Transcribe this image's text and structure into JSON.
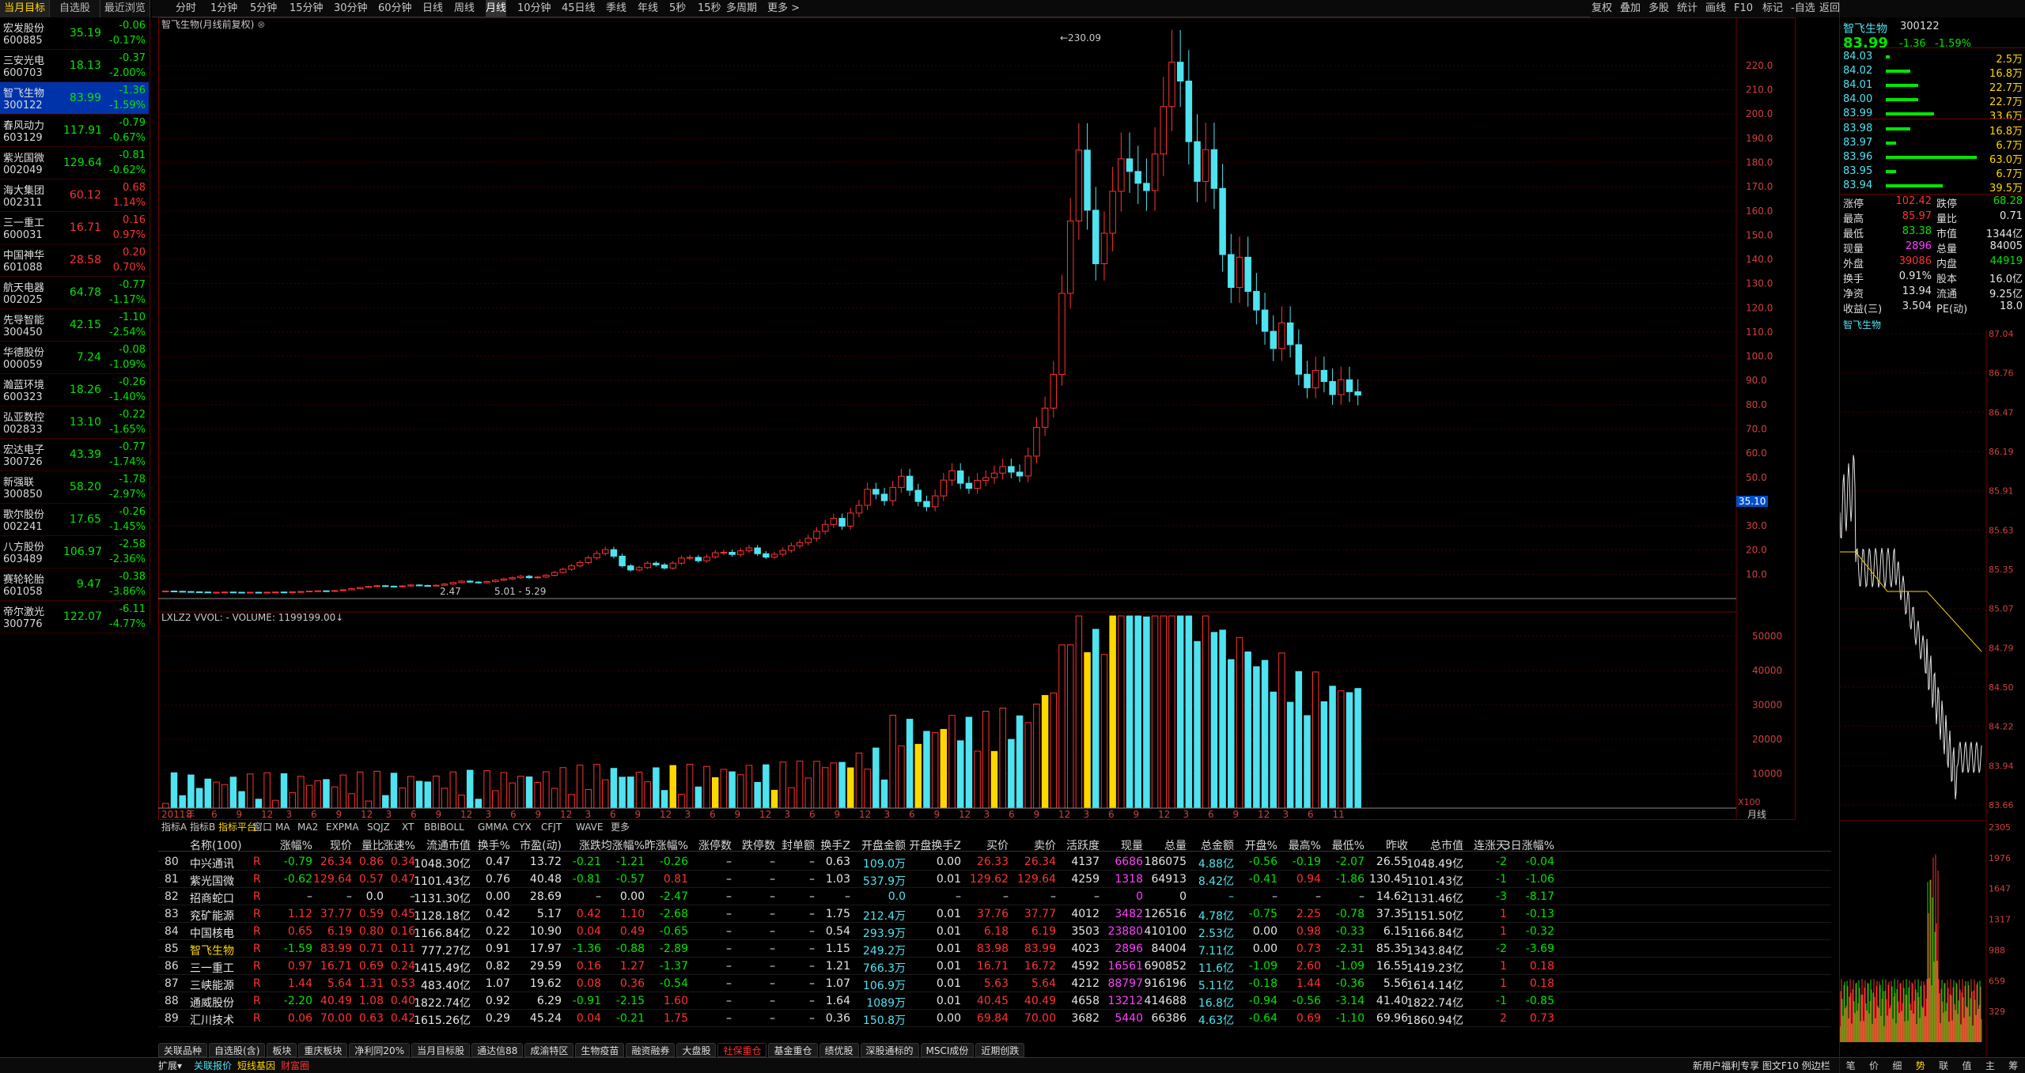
{
  "left": {
    "tabs": [
      "当月目标",
      "自选股",
      "最近浏览"
    ],
    "stocks": [
      {
        "name": "宏发股份",
        "code": "600885",
        "price": "35.19",
        "change": "-0.06",
        "pct": "-0.17%",
        "dir": "down"
      },
      {
        "name": "三安光电",
        "code": "600703",
        "price": "18.13",
        "change": "-0.37",
        "pct": "-2.00%",
        "dir": "down"
      },
      {
        "name": "智飞生物",
        "code": "300122",
        "price": "83.99",
        "change": "-1.36",
        "pct": "-1.59%",
        "dir": "down",
        "selected": true
      },
      {
        "name": "春风动力",
        "code": "603129",
        "price": "117.91",
        "change": "-0.79",
        "pct": "-0.67%",
        "dir": "down"
      },
      {
        "name": "紫光国微",
        "code": "002049",
        "price": "129.64",
        "change": "-0.81",
        "pct": "-0.62%",
        "dir": "down"
      },
      {
        "name": "海大集团",
        "code": "002311",
        "price": "60.12",
        "change": "0.68",
        "pct": "1.14%",
        "dir": "up"
      },
      {
        "name": "三一重工",
        "code": "600031",
        "price": "16.71",
        "change": "0.16",
        "pct": "0.97%",
        "dir": "up"
      },
      {
        "name": "中国神华",
        "code": "601088",
        "price": "28.58",
        "change": "0.20",
        "pct": "0.70%",
        "dir": "up"
      },
      {
        "name": "航天电器",
        "code": "002025",
        "price": "64.78",
        "change": "-0.77",
        "pct": "-1.17%",
        "dir": "down"
      },
      {
        "name": "先导智能",
        "code": "300450",
        "price": "42.15",
        "change": "-1.10",
        "pct": "-2.54%",
        "dir": "down"
      },
      {
        "name": "华德股份",
        "code": "000059",
        "price": "7.24",
        "change": "-0.08",
        "pct": "-1.09%",
        "dir": "down"
      },
      {
        "name": "瀚蓝环境",
        "code": "600323",
        "price": "18.26",
        "change": "-0.26",
        "pct": "-1.40%",
        "dir": "down"
      },
      {
        "name": "弘亚数控",
        "code": "002833",
        "price": "13.10",
        "change": "-0.22",
        "pct": "-1.65%",
        "dir": "down"
      },
      {
        "name": "宏达电子",
        "code": "300726",
        "price": "43.39",
        "change": "-0.77",
        "pct": "-1.74%",
        "dir": "down"
      },
      {
        "name": "新强联",
        "code": "300850",
        "price": "58.20",
        "change": "-1.78",
        "pct": "-2.97%",
        "dir": "down"
      },
      {
        "name": "歌尔股份",
        "code": "002241",
        "price": "17.65",
        "change": "-0.26",
        "pct": "-1.45%",
        "dir": "down"
      },
      {
        "name": "八方股份",
        "code": "603489",
        "price": "106.97",
        "change": "-2.58",
        "pct": "-2.36%",
        "dir": "down"
      },
      {
        "name": "赛轮轮胎",
        "code": "601058",
        "price": "9.47",
        "change": "-0.38",
        "pct": "-3.86%",
        "dir": "down"
      },
      {
        "name": "帝尔激光",
        "code": "300776",
        "price": "122.07",
        "change": "-6.11",
        "pct": "-4.77%",
        "dir": "down"
      }
    ]
  },
  "periods": [
    "分时",
    "1分钟",
    "5分钟",
    "15分钟",
    "30分钟",
    "60分钟",
    "日线",
    "周线",
    "月线",
    "10分钟",
    "45日线",
    "季线",
    "年线",
    "5秒",
    "15秒",
    "多周期",
    "更多 >"
  ],
  "active_period": "月线",
  "tools": [
    "复权",
    "叠加",
    "多股",
    "统计",
    "画线",
    "F10",
    "标记",
    "-自选",
    "返回"
  ],
  "chart": {
    "title": "智飞生物(月线前复权)",
    "high_label": "230.09",
    "low_label": "2.47",
    "range_label": "5.01 - 5.29",
    "vol_title": "LXLZ2 VVOL: - VOLUME: 1199199.00↓",
    "x_labels": [
      "2011年",
      "3",
      "6",
      "9",
      "12",
      "3",
      "6",
      "9",
      "12",
      "3",
      "6",
      "9",
      "12",
      "3",
      "6",
      "9",
      "12",
      "3",
      "6",
      "9",
      "12",
      "3",
      "6",
      "9",
      "12",
      "3",
      "6",
      "9",
      "12",
      "3",
      "6",
      "9",
      "12",
      "3",
      "6",
      "9",
      "12",
      "3",
      "6",
      "9",
      "12",
      "3",
      "6",
      "9",
      "12",
      "3",
      "6",
      "11"
    ],
    "price_ticks": [
      "220.0",
      "210.0",
      "200.0",
      "190.0",
      "180.0",
      "170.0",
      "160.0",
      "150.0",
      "140.0",
      "130.0",
      "120.0",
      "110.0",
      "100.0",
      "90.0",
      "80.0",
      "70.0",
      "60.0",
      "50.0",
      "40.0",
      "30.0",
      "20.0",
      "10.0"
    ],
    "vol_ticks": [
      "50000",
      "40000",
      "30000",
      "20000",
      "10000"
    ],
    "vol_unit": "X100",
    "period_label": "月线",
    "indicator_tabs": [
      "指标A",
      "指标B",
      "指标平台",
      "窗口",
      "MA",
      "MA2",
      "EXPMA",
      "SQJZ",
      "XT",
      "BBIBOLL",
      "GMMA",
      "CYX",
      "CFJT",
      "WAVE",
      "更多"
    ],
    "marker": "35.10"
  },
  "chart_data": {
    "type": "candlestick",
    "title": "智飞生物(月线前复权)",
    "closes": [
      3.1,
      3.0,
      2.9,
      2.8,
      2.7,
      2.6,
      2.6,
      2.7,
      2.6,
      2.5,
      2.6,
      2.5,
      2.6,
      2.7,
      2.6,
      2.8,
      2.9,
      3.1,
      3.2,
      3.0,
      3.3,
      3.6,
      4.1,
      4.6,
      5.0,
      5.3,
      5.1,
      4.9,
      5.2,
      5.6,
      5.4,
      5.3,
      5.5,
      6.0,
      6.6,
      7.2,
      6.8,
      6.5,
      7.0,
      7.6,
      8.1,
      8.6,
      9.2,
      8.6,
      8.9,
      9.6,
      10.8,
      12.1,
      13.5,
      14.9,
      16.8,
      18.6,
      20.2,
      17.5,
      13.5,
      11.8,
      12.8,
      14.6,
      13.9,
      12.6,
      14.6,
      16.7,
      17.0,
      15.6,
      17.2,
      18.9,
      19.1,
      18.2,
      19.7,
      20.9,
      18.5,
      17.1,
      18.3,
      19.9,
      21.8,
      23.1,
      24.9,
      27.8,
      30.6,
      33.1,
      29.9,
      35.3,
      38.5,
      45.1,
      43.1,
      40.4,
      45.9,
      50.5,
      44.7,
      40.1,
      37.9,
      42.4,
      48.9,
      52.7,
      47.6,
      45.5,
      48.8,
      49.9,
      51.8,
      54.5,
      52.2,
      50.6,
      58.8,
      70.7,
      78.6,
      92.5,
      126.0,
      155.9,
      185.1,
      160.3,
      138.2,
      150.8,
      168.1,
      181.5,
      176.3,
      171.4,
      168.4,
      183.5,
      203.1,
      221.4,
      213.6,
      188.6,
      172.2,
      185.3,
      169.3,
      142.0,
      128.4,
      140.9,
      126.8,
      119.1,
      110.3,
      103.2,
      113.8,
      104.8,
      92.6,
      87.0,
      94.2,
      89.6,
      84.2,
      90.3,
      85.4,
      83.99
    ],
    "volume_ticks": [
      50000,
      40000,
      30000,
      20000,
      10000
    ],
    "price_range": [
      0,
      230.09
    ]
  },
  "table": {
    "headers": [
      "",
      "名称(100)",
      "",
      "涨幅%",
      "现价",
      "量比",
      "涨速%",
      "流通市值",
      "换手%",
      "市盈(动)",
      "涨跌",
      "均涨幅%",
      "昨涨幅%",
      "涨停数",
      "跌停数",
      "封单额",
      "换手Z",
      "开盘金额",
      "开盘换手Z",
      "买价",
      "卖价",
      "活跃度",
      "现量",
      "总量",
      "总金额",
      "开盘%",
      "最高%",
      "最低%",
      "昨收",
      "总市值",
      "连涨天",
      "3日涨幅%"
    ],
    "rows": [
      {
        "n": "80",
        "name": "中兴通讯",
        "f": "R",
        "pct": "-0.79",
        "price": "26.34",
        "lb": "0.86",
        "zs": "0.34",
        "ltsz": "1048.30亿",
        "hs": "0.47",
        "syl": "13.72",
        "zd": "-0.21",
        "jzf": "-1.21",
        "zzf": "-0.26",
        "ztd": "–",
        "dtd": "–",
        "fd": "–",
        "hsz": "0.63",
        "kpje": "109.0万",
        "kphs": "0.00",
        "buy": "26.33",
        "sell": "26.34",
        "hyd": "4137",
        "xl": "6686",
        "zl": "186075",
        "zje": "4.88亿",
        "kp": "-0.56",
        "zg": "-0.19",
        "zd2": "-2.07",
        "zs2": "26.55",
        "zsz": "1048.49亿",
        "lzt": "-2",
        "zf3": "-0.04"
      },
      {
        "n": "81",
        "name": "紫光国微",
        "f": "R",
        "pct": "-0.62",
        "price": "129.64",
        "lb": "0.57",
        "zs": "0.47",
        "ltsz": "1101.43亿",
        "hs": "0.76",
        "syl": "40.48",
        "zd": "-0.81",
        "jzf": "-0.57",
        "zzf": "0.81",
        "ztd": "–",
        "dtd": "–",
        "fd": "–",
        "hsz": "1.03",
        "kpje": "537.9万",
        "kphs": "0.01",
        "buy": "129.62",
        "sell": "129.64",
        "hyd": "4259",
        "xl": "1318",
        "zl": "64913",
        "zje": "8.42亿",
        "kp": "-0.41",
        "zg": "0.94",
        "zd2": "-1.86",
        "zs2": "130.45",
        "zsz": "1101.43亿",
        "lzt": "-1",
        "zf3": "-1.06"
      },
      {
        "n": "82",
        "name": "招商蛇口",
        "f": "R",
        "pct": "–",
        "price": "–",
        "lb": "0.0",
        "zs": "–",
        "ltsz": "1131.30亿",
        "hs": "0.00",
        "syl": "28.69",
        "zd": "–",
        "jzf": "0.00",
        "zzf": "-2.47",
        "ztd": "–",
        "dtd": "–",
        "fd": "–",
        "hsz": "–",
        "kpje": "0.0",
        "kphs": "–",
        "buy": "–",
        "sell": "–",
        "hyd": "–",
        "xl": "0",
        "zl": "0",
        "zje": "–",
        "kp": "–",
        "zg": "–",
        "zd2": "–",
        "zs2": "14.62",
        "zsz": "1131.46亿",
        "lzt": "-3",
        "zf3": "-8.17"
      },
      {
        "n": "83",
        "name": "兖矿能源",
        "f": "R",
        "pct": "1.12",
        "price": "37.77",
        "lb": "0.59",
        "zs": "0.45",
        "ltsz": "1128.18亿",
        "hs": "0.42",
        "syl": "5.17",
        "zd": "0.42",
        "jzf": "1.10",
        "zzf": "-2.68",
        "ztd": "–",
        "dtd": "–",
        "fd": "–",
        "hsz": "1.75",
        "kpje": "212.4万",
        "kphs": "0.01",
        "buy": "37.76",
        "sell": "37.77",
        "hyd": "4012",
        "xl": "3482",
        "zl": "126516",
        "zje": "4.78亿",
        "kp": "-0.75",
        "zg": "2.25",
        "zd2": "-0.78",
        "zs2": "37.35",
        "zsz": "1151.50亿",
        "lzt": "1",
        "zf3": "-0.13"
      },
      {
        "n": "84",
        "name": "中国核电",
        "f": "R",
        "pct": "0.65",
        "price": "6.19",
        "lb": "0.80",
        "zs": "0.16",
        "ltsz": "1166.84亿",
        "hs": "0.22",
        "syl": "10.90",
        "zd": "0.04",
        "jzf": "0.49",
        "zzf": "-0.65",
        "ztd": "–",
        "dtd": "–",
        "fd": "–",
        "hsz": "0.54",
        "kpje": "293.9万",
        "kphs": "0.01",
        "buy": "6.18",
        "sell": "6.19",
        "hyd": "3503",
        "xl": "23880",
        "zl": "410100",
        "zje": "2.53亿",
        "kp": "0.00",
        "zg": "0.98",
        "zd2": "-0.33",
        "zs2": "6.15",
        "zsz": "1166.84亿",
        "lzt": "1",
        "zf3": "-0.32"
      },
      {
        "n": "85",
        "name": "智飞生物",
        "f": "R",
        "pct": "-1.59",
        "price": "83.99",
        "lb": "0.71",
        "zs": "0.11",
        "ltsz": "777.27亿",
        "hs": "0.91",
        "syl": "17.97",
        "zd": "-1.36",
        "jzf": "-0.88",
        "zzf": "-2.89",
        "ztd": "–",
        "dtd": "–",
        "fd": "–",
        "hsz": "1.15",
        "kpje": "249.2万",
        "kphs": "0.01",
        "buy": "83.98",
        "sell": "83.99",
        "hyd": "4023",
        "xl": "2896",
        "zl": "84004",
        "zje": "7.11亿",
        "kp": "0.00",
        "zg": "0.73",
        "zd2": "-2.31",
        "zs2": "85.35",
        "zsz": "1343.84亿",
        "lzt": "-2",
        "zf3": "-3.69",
        "hl": true
      },
      {
        "n": "86",
        "name": "三一重工",
        "f": "R",
        "pct": "0.97",
        "price": "16.71",
        "lb": "0.69",
        "zs": "0.24",
        "ltsz": "1415.49亿",
        "hs": "0.82",
        "syl": "29.59",
        "zd": "0.16",
        "jzf": "1.27",
        "zzf": "-1.37",
        "ztd": "–",
        "dtd": "–",
        "fd": "–",
        "hsz": "1.21",
        "kpje": "766.3万",
        "kphs": "0.01",
        "buy": "16.71",
        "sell": "16.72",
        "hyd": "4592",
        "xl": "16561",
        "zl": "690852",
        "zje": "11.6亿",
        "kp": "-1.09",
        "zg": "2.60",
        "zd2": "-1.09",
        "zs2": "16.55",
        "zsz": "1419.23亿",
        "lzt": "1",
        "zf3": "0.18"
      },
      {
        "n": "87",
        "name": "三峡能源",
        "f": "R",
        "pct": "1.44",
        "price": "5.64",
        "lb": "1.31",
        "zs": "0.53",
        "ltsz": "483.40亿",
        "hs": "1.07",
        "syl": "19.62",
        "zd": "0.08",
        "jzf": "0.36",
        "zzf": "-0.54",
        "ztd": "–",
        "dtd": "–",
        "fd": "–",
        "hsz": "1.07",
        "kpje": "106.9万",
        "kphs": "0.01",
        "buy": "5.63",
        "sell": "5.64",
        "hyd": "4212",
        "xl": "88797",
        "zl": "916196",
        "zje": "5.11亿",
        "kp": "-0.18",
        "zg": "1.44",
        "zd2": "-0.36",
        "zs2": "5.56",
        "zsz": "1614.14亿",
        "lzt": "1",
        "zf3": "0.18"
      },
      {
        "n": "88",
        "name": "通威股份",
        "f": "R",
        "pct": "-2.20",
        "price": "40.49",
        "lb": "1.08",
        "zs": "0.40",
        "ltsz": "1822.74亿",
        "hs": "0.92",
        "syl": "6.29",
        "zd": "-0.91",
        "jzf": "-2.15",
        "zzf": "1.60",
        "ztd": "–",
        "dtd": "–",
        "fd": "–",
        "hsz": "1.64",
        "kpje": "1089万",
        "kphs": "0.01",
        "buy": "40.45",
        "sell": "40.49",
        "hyd": "4658",
        "xl": "13212",
        "zl": "414688",
        "zje": "16.8亿",
        "kp": "-0.94",
        "zg": "-0.56",
        "zd2": "-3.14",
        "zs2": "41.40",
        "zsz": "1822.74亿",
        "lzt": "-1",
        "zf3": "-0.85"
      },
      {
        "n": "89",
        "name": "汇川技术",
        "f": "R",
        "pct": "0.06",
        "price": "70.00",
        "lb": "0.63",
        "zs": "0.42",
        "ltsz": "1615.26亿",
        "hs": "0.29",
        "syl": "45.24",
        "zd": "0.04",
        "jzf": "-0.21",
        "zzf": "1.75",
        "ztd": "–",
        "dtd": "–",
        "fd": "–",
        "hsz": "0.36",
        "kpje": "150.8万",
        "kphs": "0.00",
        "buy": "69.84",
        "sell": "70.00",
        "hyd": "3682",
        "xl": "5440",
        "zl": "66386",
        "zje": "4.63亿",
        "kp": "-0.64",
        "zg": "0.69",
        "zd2": "-1.10",
        "zs2": "69.96",
        "zsz": "1860.94亿",
        "lzt": "2",
        "zf3": "0.73"
      }
    ]
  },
  "bottom_tabs": [
    "关联品种",
    "自选股(含)",
    "板块",
    "重庆板块",
    "净利同20%",
    "当月目标股",
    "通达信88",
    "成渝特区",
    "生物疫苗",
    "融资融券",
    "大盘股",
    "社保重仓",
    "基金重仓",
    "绩优股",
    "深股通标的",
    "MSCI成份",
    "近期创跌"
  ],
  "bottom_active": "社保重仓",
  "status": {
    "left": [
      "扩展▾",
      "关联报价",
      "短线基因",
      "财富圈"
    ],
    "right": "新用户福利专享 图文F10 例边栏",
    "right_tabs": [
      "笔",
      "价",
      "细",
      "势",
      "联",
      "值",
      "主",
      "筹"
    ]
  },
  "right": {
    "name": "智飞生物",
    "code": "300122",
    "price": "83.99",
    "change": "-1.36",
    "pct": "-1.59%",
    "sell_book": [
      {
        "p": "84.03",
        "v": "2.5万",
        "w": 0.04
      },
      {
        "p": "84.02",
        "v": "16.8万",
        "w": 0.27
      },
      {
        "p": "84.01",
        "v": "22.7万",
        "w": 0.36
      },
      {
        "p": "84.00",
        "v": "22.7万",
        "w": 0.36
      },
      {
        "p": "83.99",
        "v": "33.6万",
        "w": 0.53
      }
    ],
    "buy_book": [
      {
        "p": "83.98",
        "v": "16.8万",
        "w": 0.27
      },
      {
        "p": "83.97",
        "v": "6.7万",
        "w": 0.11
      },
      {
        "p": "83.96",
        "v": "63.0万",
        "w": 1.0
      },
      {
        "p": "83.95",
        "v": "6.7万",
        "w": 0.11
      },
      {
        "p": "83.94",
        "v": "39.5万",
        "w": 0.63
      }
    ],
    "quote": [
      [
        "涨停",
        "102.42",
        "跌停",
        "68.28"
      ],
      [
        "最高",
        "85.97",
        "量比",
        "0.71"
      ],
      [
        "最低",
        "83.38",
        "市值",
        "1344亿"
      ],
      [
        "现量",
        "2896",
        "总量",
        "84005"
      ],
      [
        "外盘",
        "39086",
        "内盘",
        "44919"
      ],
      [
        "换手",
        "0.91%",
        "股本",
        "16.0亿"
      ],
      [
        "净资",
        "13.94",
        "流通",
        "9.25亿"
      ],
      [
        "收益(三)",
        "3.504",
        "PE(动)",
        "18.0"
      ]
    ],
    "mini_title": "智飞生物",
    "mini_ticks": [
      "87.04",
      "86.76",
      "86.47",
      "86.19",
      "85.91",
      "85.63",
      "85.35",
      "85.07",
      "84.79",
      "84.50",
      "84.22",
      "83.94",
      "83.66"
    ],
    "vol_ticks": [
      "2305",
      "1976",
      "1647",
      "1317",
      "988",
      "659",
      "329"
    ]
  }
}
